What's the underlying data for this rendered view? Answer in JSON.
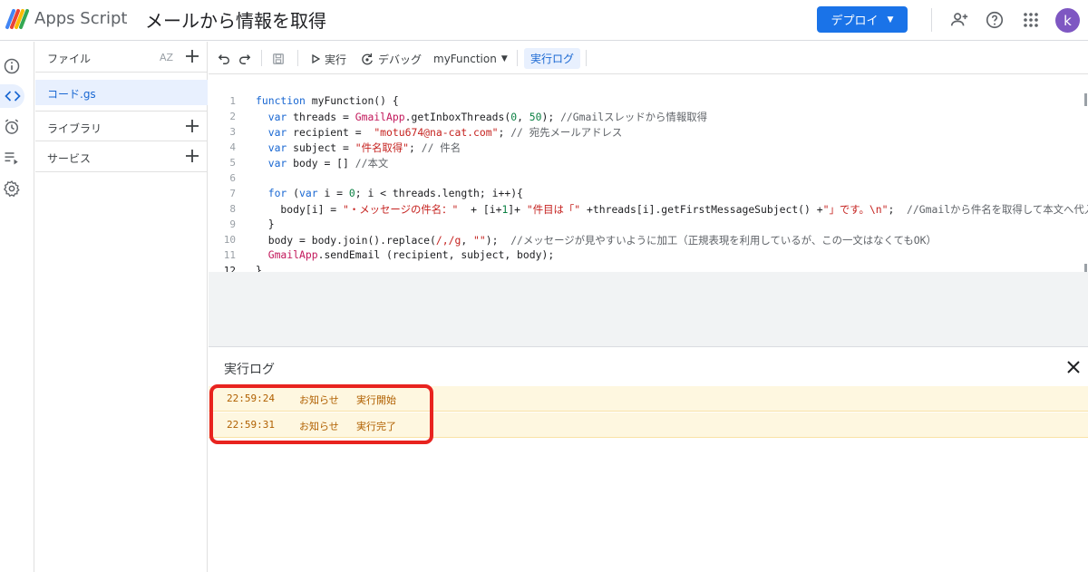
{
  "header": {
    "app_name": "Apps Script",
    "project_title": "メールから情報を取得",
    "deploy_label": "デプロイ",
    "avatar_initial": "k"
  },
  "files_panel": {
    "files_label": "ファイル",
    "sort_label": "AZ",
    "file_name": "コード.gs",
    "libraries_label": "ライブラリ",
    "services_label": "サービス"
  },
  "toolbar": {
    "run_label": "実行",
    "debug_label": "デバッグ",
    "function_name": "myFunction",
    "execution_log_label": "実行ログ"
  },
  "editor": {
    "line_numbers": [
      "1",
      "2",
      "3",
      "4",
      "5",
      "6",
      "7",
      "8",
      "9",
      "10",
      "11",
      "12"
    ]
  },
  "execution_log": {
    "title": "実行ログ",
    "rows": [
      {
        "time": "22:59:24",
        "level": "お知らせ",
        "message": "実行開始"
      },
      {
        "time": "22:59:31",
        "level": "お知らせ",
        "message": "実行完了"
      }
    ]
  },
  "colors": {
    "accent": "#1a73e8",
    "log_background": "#fef7e0",
    "highlight": "#e8231f",
    "avatar": "#7e57c2"
  }
}
